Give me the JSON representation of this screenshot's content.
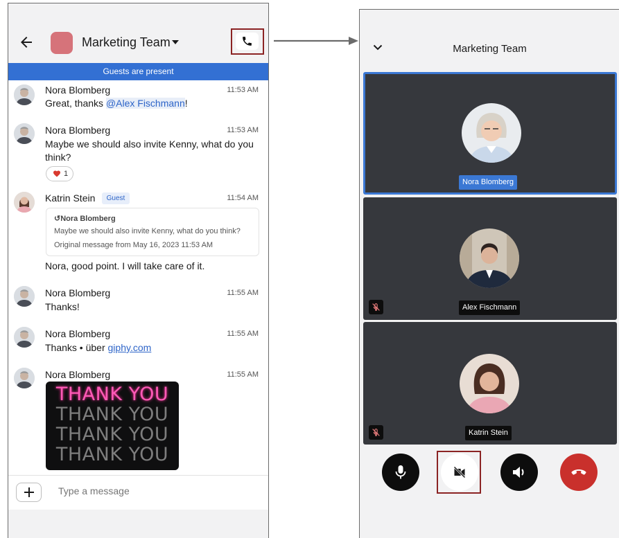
{
  "chat": {
    "title": "Marketing Team",
    "guest_banner": "Guests are present",
    "messages": [
      {
        "author": "Nora Blomberg",
        "time": "11:53 AM",
        "text_before": "Great, thanks ",
        "mention": "@Alex Fischmann",
        "text_after": "!"
      },
      {
        "author": "Nora Blomberg",
        "time": "11:53 AM",
        "text": "Maybe we should also invite Kenny, what do you think?",
        "reaction_count": "1"
      },
      {
        "author": "Katrin Stein",
        "badge": "Guest",
        "time": "11:54 AM",
        "quote_author": "Nora Blomberg",
        "quote_text": "Maybe we should also invite Kenny, what do you think?",
        "quote_meta": "Original message from May 16, 2023 11:53 AM",
        "text": "Nora, good point. I will take care of it."
      },
      {
        "author": "Nora Blomberg",
        "time": "11:55 AM",
        "text": "Thanks!"
      },
      {
        "author": "Nora Blomberg",
        "time": "11:55 AM",
        "text_before": "Thanks • über ",
        "link": "giphy.com"
      },
      {
        "author": "Nora Blomberg",
        "time": "11:55 AM",
        "gif_lines": [
          "THANK YOU",
          "THANK YOU",
          "THANK YOU",
          "THANK YOU"
        ]
      }
    ],
    "composer": {
      "placeholder": "Type a message"
    }
  },
  "call": {
    "title": "Marketing Team",
    "participants": [
      {
        "name": "Nora Blomberg",
        "active": true,
        "muted": false
      },
      {
        "name": "Alex Fischmann",
        "active": false,
        "muted": true
      },
      {
        "name": "Katrin Stein",
        "active": false,
        "muted": true
      }
    ]
  },
  "colors": {
    "accent": "#3370d3",
    "hangup": "#c9302c",
    "highlight_box": "#8b2323"
  }
}
